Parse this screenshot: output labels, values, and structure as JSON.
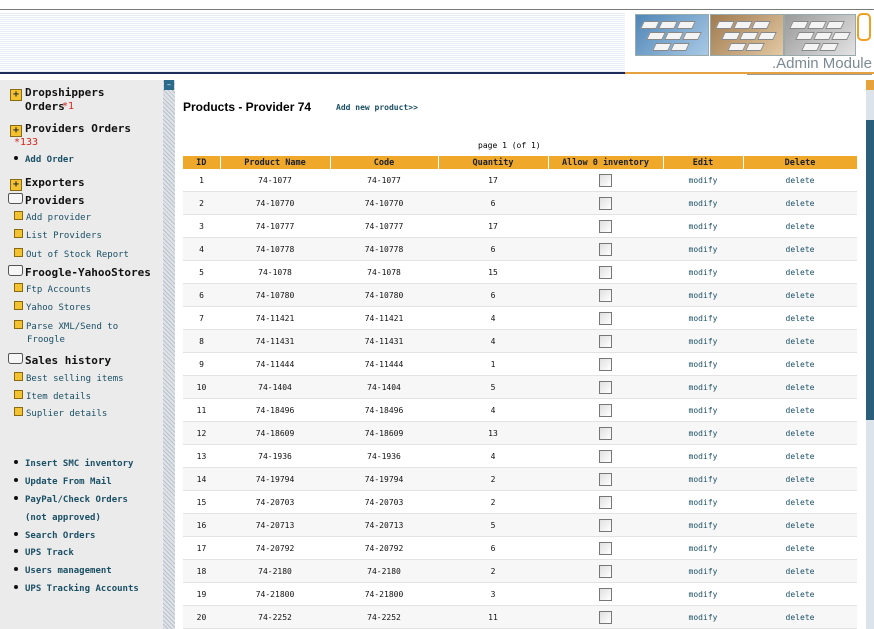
{
  "header": {
    "admin_label": ".Admin Module"
  },
  "sidebar": {
    "dropshippers_orders": "Dropshippers Orders",
    "dropshippers_count": "*1",
    "providers_orders": "Providers Orders",
    "providers_count": "*133",
    "add_order": "Add Order",
    "exporters": "Exporters",
    "providers": "Providers",
    "providers_items": [
      "Add provider",
      "List Providers",
      "Out of Stock Report"
    ],
    "froogle": "Froogle-YahooStores",
    "froogle_items": [
      "Ftp Accounts",
      "Yahoo Stores",
      "Parse XML/Send to",
      "Froogle"
    ],
    "sales_history": "Sales history",
    "sales_items": [
      "Best selling items",
      "Item details",
      "Suplier details"
    ],
    "bottom_links": [
      "Insert SMC inventory",
      "Update From Mail",
      "PayPal/Check Orders",
      "(not approved)",
      "Search Orders",
      "UPS Track",
      "Users management",
      "UPS Tracking Accounts"
    ]
  },
  "main": {
    "title": "Products - Provider 74",
    "add_link": "Add new product>>",
    "page_info": "page 1 (of 1)",
    "columns": [
      "ID",
      "Product Name",
      "Code",
      "Quantity",
      "Allow 0 inventory",
      "Edit",
      "Delete"
    ],
    "rows": [
      {
        "id": "1",
        "name": "74-1077",
        "code": "74-1077",
        "qty": "17",
        "edit": "modify",
        "del": "delete"
      },
      {
        "id": "2",
        "name": "74-10770",
        "code": "74-10770",
        "qty": "6",
        "edit": "modify",
        "del": "delete"
      },
      {
        "id": "3",
        "name": "74-10777",
        "code": "74-10777",
        "qty": "17",
        "edit": "modify",
        "del": "delete"
      },
      {
        "id": "4",
        "name": "74-10778",
        "code": "74-10778",
        "qty": "6",
        "edit": "modify",
        "del": "delete"
      },
      {
        "id": "5",
        "name": "74-1078",
        "code": "74-1078",
        "qty": "15",
        "edit": "modify",
        "del": "delete"
      },
      {
        "id": "6",
        "name": "74-10780",
        "code": "74-10780",
        "qty": "6",
        "edit": "modify",
        "del": "delete"
      },
      {
        "id": "7",
        "name": "74-11421",
        "code": "74-11421",
        "qty": "4",
        "edit": "modify",
        "del": "delete"
      },
      {
        "id": "8",
        "name": "74-11431",
        "code": "74-11431",
        "qty": "4",
        "edit": "modify",
        "del": "delete"
      },
      {
        "id": "9",
        "name": "74-11444",
        "code": "74-11444",
        "qty": "1",
        "edit": "modify",
        "del": "delete"
      },
      {
        "id": "10",
        "name": "74-1404",
        "code": "74-1404",
        "qty": "5",
        "edit": "modify",
        "del": "delete"
      },
      {
        "id": "11",
        "name": "74-18496",
        "code": "74-18496",
        "qty": "4",
        "edit": "modify",
        "del": "delete"
      },
      {
        "id": "12",
        "name": "74-18609",
        "code": "74-18609",
        "qty": "13",
        "edit": "modify",
        "del": "delete"
      },
      {
        "id": "13",
        "name": "74-1936",
        "code": "74-1936",
        "qty": "4",
        "edit": "modify",
        "del": "delete"
      },
      {
        "id": "14",
        "name": "74-19794",
        "code": "74-19794",
        "qty": "2",
        "edit": "modify",
        "del": "delete"
      },
      {
        "id": "15",
        "name": "74-20703",
        "code": "74-20703",
        "qty": "2",
        "edit": "modify",
        "del": "delete"
      },
      {
        "id": "16",
        "name": "74-20713",
        "code": "74-20713",
        "qty": "5",
        "edit": "modify",
        "del": "delete"
      },
      {
        "id": "17",
        "name": "74-20792",
        "code": "74-20792",
        "qty": "6",
        "edit": "modify",
        "del": "delete"
      },
      {
        "id": "18",
        "name": "74-2180",
        "code": "74-2180",
        "qty": "2",
        "edit": "modify",
        "del": "delete"
      },
      {
        "id": "19",
        "name": "74-21800",
        "code": "74-21800",
        "qty": "3",
        "edit": "modify",
        "del": "delete"
      },
      {
        "id": "20",
        "name": "74-2252",
        "code": "74-2252",
        "qty": "11",
        "edit": "modify",
        "del": "delete"
      }
    ]
  },
  "colors": {
    "header_accent": "#f0a82a",
    "link": "#1a4f64",
    "alert": "#d3241c",
    "nav_dark": "#1c2c5a"
  },
  "icons": [
    "keyboard-banner-icon",
    "plus-box-icon",
    "folder-icon",
    "bullet-icon",
    "checkbox-icon"
  ]
}
